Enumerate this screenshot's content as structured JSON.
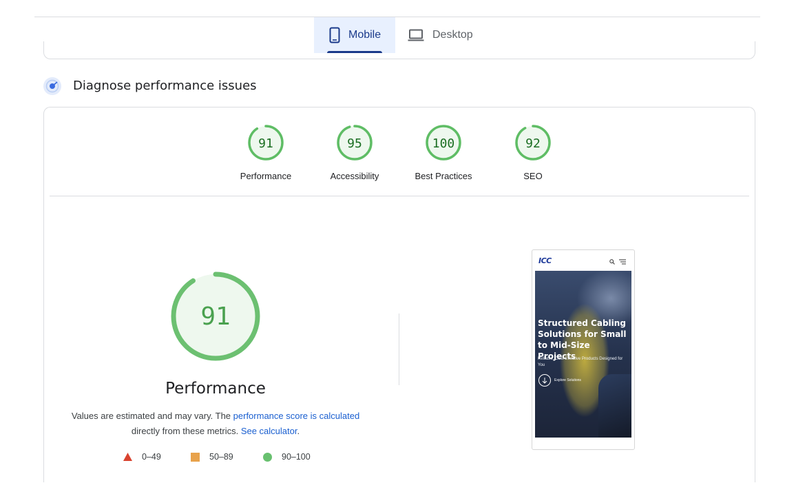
{
  "tabs": [
    {
      "label": "Mobile",
      "active": true,
      "icon": "smartphone-icon"
    },
    {
      "label": "Desktop",
      "active": false,
      "icon": "laptop-icon"
    }
  ],
  "section": {
    "title": "Diagnose performance issues",
    "icon": "lighthouse-icon"
  },
  "scores": [
    {
      "value": 91,
      "label": "Performance"
    },
    {
      "value": 95,
      "label": "Accessibility"
    },
    {
      "value": 100,
      "label": "Best Practices"
    },
    {
      "value": 92,
      "label": "SEO"
    }
  ],
  "performance": {
    "score": 91,
    "title": "Performance",
    "desc_prefix": "Values are estimated and may vary. The ",
    "desc_link1": "performance score is calculated",
    "desc_middle": " directly from these metrics. ",
    "desc_link2": "See calculator",
    "desc_suffix": "."
  },
  "legend": [
    {
      "label": "0–49",
      "shape": "triangle",
      "color": "#d9432f"
    },
    {
      "label": "50–89",
      "shape": "square",
      "color": "#e8a24b"
    },
    {
      "label": "90–100",
      "shape": "circle",
      "color": "#68c06f"
    }
  ],
  "colors": {
    "pass": "#5fbd65",
    "pass_fill": "#eef8ee",
    "pass_text": "#1b6e22",
    "accent": "#1a3a8a"
  },
  "screenshot": {
    "logo": "ICC",
    "hero_title": "Structured Cabling Solutions for Small to Mid-Size Projects",
    "hero_subtitle": "Reliable, Cost-Effective Products Designed for You",
    "cta": "Explore Solutions"
  }
}
